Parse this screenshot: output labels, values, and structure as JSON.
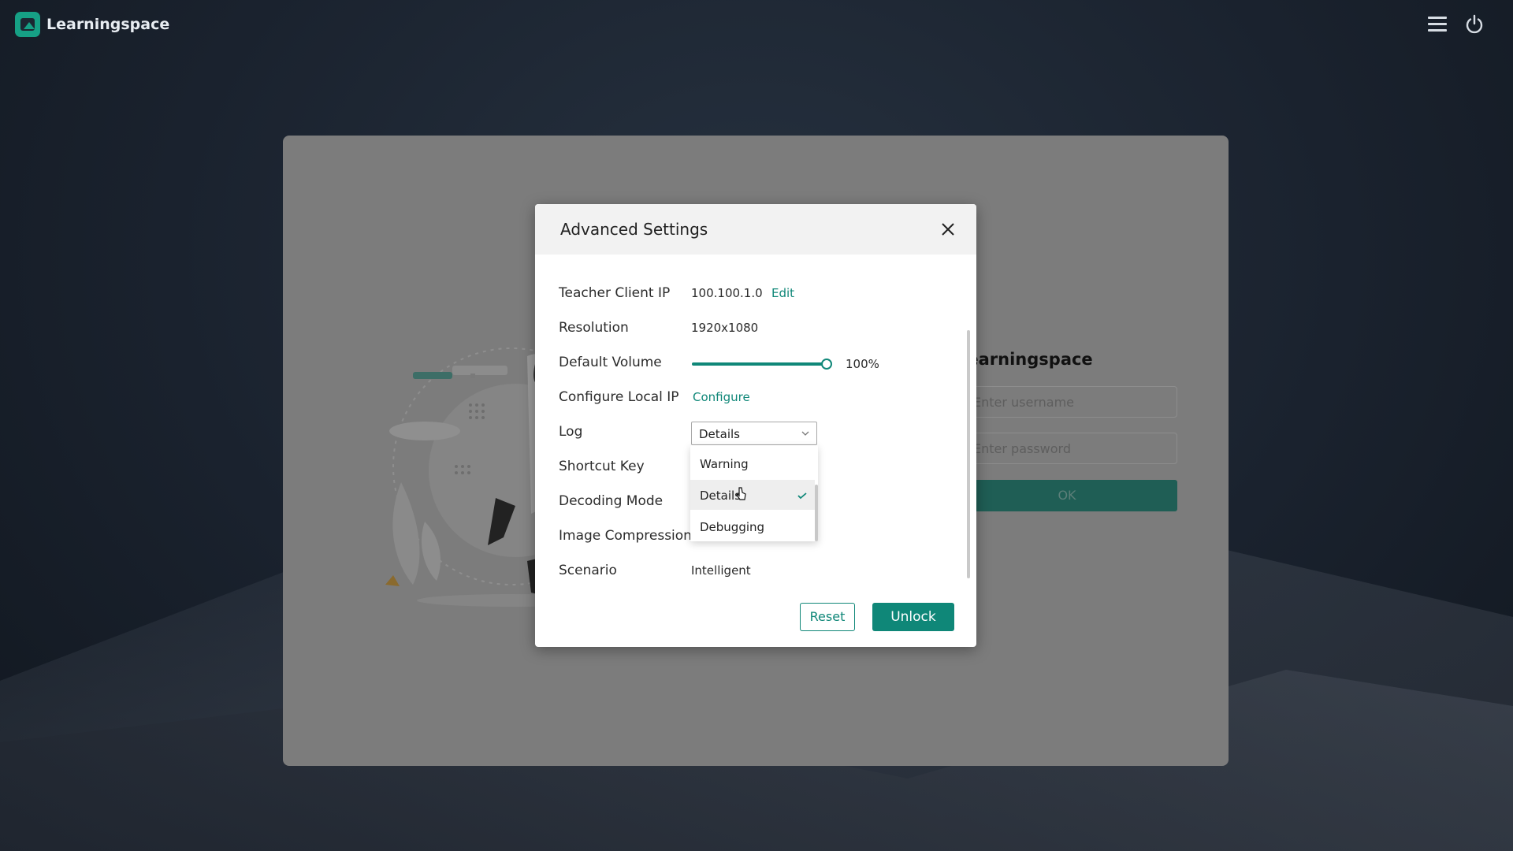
{
  "app": {
    "title": "Learningspace"
  },
  "header": {
    "menu_icon": "hamburger-menu-icon",
    "power_icon": "power-icon"
  },
  "login": {
    "title": "Learningspace",
    "username_placeholder": "Enter username",
    "password_placeholder": "Enter password",
    "ok_label": "OK"
  },
  "modal": {
    "title": "Advanced Settings",
    "rows": {
      "teacher_ip": {
        "label": "Teacher Client IP",
        "value": "100.100.1.0",
        "action": "Edit"
      },
      "resolution": {
        "label": "Resolution",
        "value": "1920x1080"
      },
      "volume": {
        "label": "Default Volume",
        "value": "100%",
        "level": 1.0
      },
      "local_ip": {
        "label": "Configure Local IP",
        "action": "Configure"
      },
      "log": {
        "label": "Log",
        "value": "Details"
      },
      "shortcut": {
        "label": "Shortcut Key"
      },
      "decoding": {
        "label": "Decoding Mode"
      },
      "compression": {
        "label": "Image Compression"
      },
      "scenario": {
        "label": "Scenario",
        "value": "Intelligent"
      }
    },
    "log_options": [
      "Warning",
      "Details",
      "Debugging"
    ],
    "log_selected": "Details",
    "buttons": {
      "reset": "Reset",
      "unlock": "Unlock"
    }
  },
  "colors": {
    "accent": "#0f8778",
    "logo": "#16a085"
  }
}
